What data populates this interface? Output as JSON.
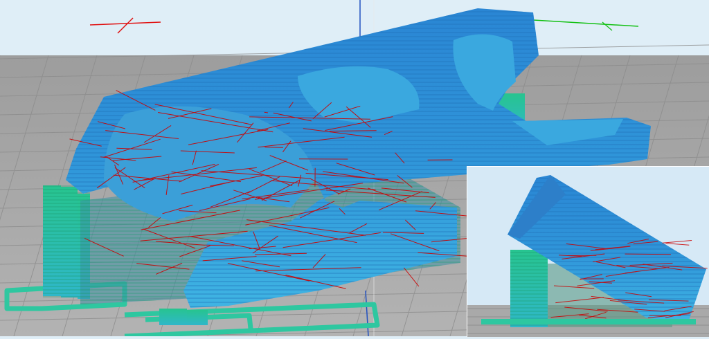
{
  "viewport": {
    "background_color": "#dfeef7",
    "build_plate_color": "#a6a6a6",
    "grid_line_color": "#8a8a8a",
    "model_shell_color": "#2f8fd6",
    "model_shell_highlight": "#3fb4e6",
    "support_color": "#23c59a",
    "travel_move_color": "#cc0000",
    "axis_x_color": "#ff0000",
    "axis_y_color": "#00cc00",
    "axis_z_color": "#1f57c8"
  },
  "inset_view": {
    "background_color": "#d6e9f6",
    "view": "side"
  }
}
